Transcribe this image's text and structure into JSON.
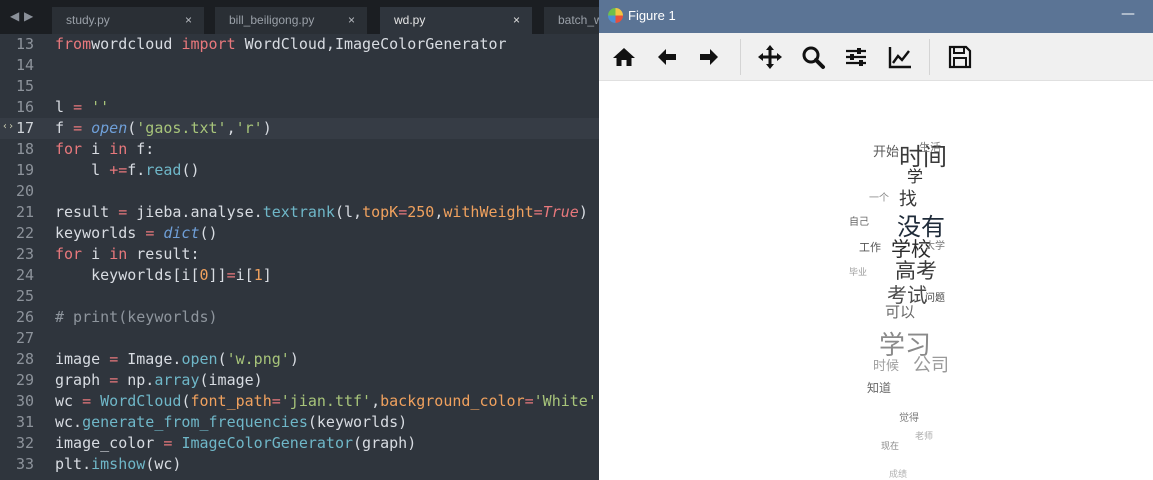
{
  "editor": {
    "tabs": [
      {
        "label": "study.py",
        "close": "×"
      },
      {
        "label": "bill_beiligong.py",
        "close": "×"
      },
      {
        "label": "wd.py",
        "close": "×"
      },
      {
        "label": "batch_w",
        "close": ""
      }
    ],
    "nav_back": "◀",
    "nav_forward": "▶",
    "lint_marker": "‹›",
    "line_numbers": [
      "13",
      "14",
      "15",
      "16",
      "17",
      "18",
      "19",
      "20",
      "21",
      "22",
      "23",
      "24",
      "25",
      "26",
      "27",
      "28",
      "29",
      "30",
      "31",
      "32",
      "33"
    ],
    "current_line": "17",
    "lines": [
      [
        [
          "kw",
          "from"
        ],
        [
          "",
          "wordcloud "
        ],
        [
          "kw",
          "import"
        ],
        [
          "",
          " WordCloud,ImageColorGenerator"
        ]
      ],
      [],
      [],
      [
        [
          "",
          "l "
        ],
        [
          "op",
          "="
        ],
        [
          "",
          ""
        ],
        [
          "st",
          " ''"
        ]
      ],
      [
        [
          "",
          "f "
        ],
        [
          "op",
          "="
        ],
        [
          "",
          " "
        ],
        [
          "bi",
          "open"
        ],
        [
          "",
          "("
        ],
        [
          "st",
          "'gaos.txt'"
        ],
        [
          "",
          ","
        ],
        [
          "st",
          "'r'"
        ],
        [
          "",
          ")"
        ]
      ],
      [
        [
          "kw",
          "for"
        ],
        [
          "",
          " i "
        ],
        [
          "kw",
          "in"
        ],
        [
          "",
          " f:"
        ]
      ],
      [
        [
          "",
          "    l "
        ],
        [
          "op",
          "+="
        ],
        [
          "",
          "f."
        ],
        [
          "fn",
          "read"
        ],
        [
          "",
          "()"
        ]
      ],
      [],
      [
        [
          "",
          "result "
        ],
        [
          "op",
          "="
        ],
        [
          "",
          " jieba.analyse."
        ],
        [
          "fn",
          "textrank"
        ],
        [
          "",
          "(l,"
        ],
        [
          "pa",
          "topK"
        ],
        [
          "op",
          "="
        ],
        [
          "nu",
          "250"
        ],
        [
          "",
          ","
        ],
        [
          "pa",
          "withWeight"
        ],
        [
          "op",
          "="
        ],
        [
          "tr",
          "True"
        ],
        [
          "",
          ")"
        ]
      ],
      [
        [
          "",
          "keyworlds "
        ],
        [
          "op",
          "="
        ],
        [
          "",
          " "
        ],
        [
          "bi",
          "dict"
        ],
        [
          "",
          "()"
        ]
      ],
      [
        [
          "kw",
          "for"
        ],
        [
          "",
          " i "
        ],
        [
          "kw",
          "in"
        ],
        [
          "",
          " result:"
        ]
      ],
      [
        [
          "",
          "    keyworlds[i["
        ],
        [
          "nu",
          "0"
        ],
        [
          "",
          "]]"
        ],
        [
          "op",
          "="
        ],
        [
          "",
          "i["
        ],
        [
          "nu",
          "1"
        ],
        [
          "",
          "]"
        ]
      ],
      [],
      [
        [
          "co",
          "# print(keyworlds)"
        ]
      ],
      [],
      [
        [
          "",
          "image "
        ],
        [
          "op",
          "="
        ],
        [
          "",
          " Image."
        ],
        [
          "fn",
          "open"
        ],
        [
          "",
          "("
        ],
        [
          "st",
          "'w.png'"
        ],
        [
          "",
          ")"
        ]
      ],
      [
        [
          "",
          "graph "
        ],
        [
          "op",
          "="
        ],
        [
          "",
          " np."
        ],
        [
          "fn",
          "array"
        ],
        [
          "",
          "(image)"
        ]
      ],
      [
        [
          "",
          "wc "
        ],
        [
          "op",
          "="
        ],
        [
          "",
          " "
        ],
        [
          "fn",
          "WordCloud"
        ],
        [
          "",
          "("
        ],
        [
          "pa",
          "font_path"
        ],
        [
          "op",
          "="
        ],
        [
          "st",
          "'jian.ttf'"
        ],
        [
          "",
          ","
        ],
        [
          "pa",
          "background_color"
        ],
        [
          "op",
          "="
        ],
        [
          "st",
          "'White'"
        ],
        [
          "",
          ","
        ]
      ],
      [
        [
          "",
          "wc."
        ],
        [
          "fn",
          "generate_from_frequencies"
        ],
        [
          "",
          "(keyworlds)"
        ]
      ],
      [
        [
          "",
          "image_color "
        ],
        [
          "op",
          "="
        ],
        [
          "",
          " "
        ],
        [
          "fn",
          "ImageColorGenerator"
        ],
        [
          "",
          "(graph)"
        ]
      ],
      [
        [
          "",
          "plt."
        ],
        [
          "fn",
          "imshow"
        ],
        [
          "",
          "(wc)"
        ]
      ]
    ]
  },
  "figure": {
    "title": "Figure 1",
    "minimize": "—",
    "toolbar": {
      "home": "home-icon",
      "back": "arrow-left-icon",
      "forward": "arrow-right-icon",
      "pan": "move-icon",
      "zoom": "zoom-icon",
      "configure": "sliders-icon",
      "edit": "chart-line-icon",
      "save": "floppy-disk-icon"
    },
    "wordcloud": [
      {
        "text": "时间",
        "color": "#3a3a3a"
      },
      {
        "text": "开始",
        "color": "#5a5a5a"
      },
      {
        "text": "学",
        "color": "#2e2e2e"
      },
      {
        "text": "找",
        "color": "#3a3a3a"
      },
      {
        "text": "没有",
        "color": "#1e2a38"
      },
      {
        "text": "学校",
        "color": "#2a2a2a"
      },
      {
        "text": "高考",
        "color": "#3a3a3a"
      },
      {
        "text": "考试",
        "color": "#4a4a4a"
      },
      {
        "text": "可以",
        "color": "#6a6a6a"
      },
      {
        "text": "学习",
        "color": "#8a8a8a"
      },
      {
        "text": "公司",
        "color": "#9a9a9a"
      },
      {
        "text": "时候",
        "color": "#a0a0a0"
      },
      {
        "text": "生活",
        "color": "#7a7a7a"
      },
      {
        "text": "一个",
        "color": "#888888"
      },
      {
        "text": "自己",
        "color": "#666666"
      },
      {
        "text": "工作",
        "color": "#555555"
      },
      {
        "text": "大学",
        "color": "#777777"
      },
      {
        "text": "毕业",
        "color": "#999999"
      },
      {
        "text": "问题",
        "color": "#444444"
      },
      {
        "text": "知道",
        "color": "#6a6a6a"
      },
      {
        "text": "觉得",
        "color": "#7a7a7a"
      },
      {
        "text": "现在",
        "color": "#8a8a8a"
      },
      {
        "text": "成绩",
        "color": "#b0b0b0"
      },
      {
        "text": "老师",
        "color": "#aaaaaa"
      }
    ]
  }
}
